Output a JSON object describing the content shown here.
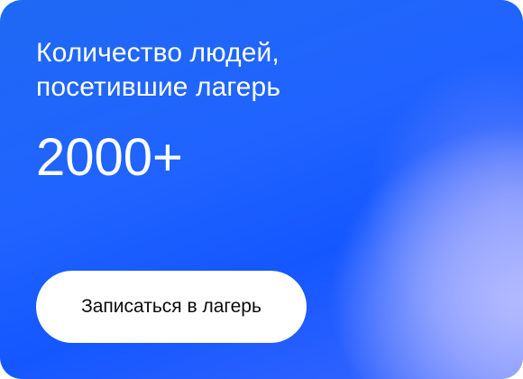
{
  "card": {
    "title_line1": "Количество людей,",
    "title_line2": "посетившие лагерь",
    "count": "2000+",
    "cta_label": "Записаться в лагерь"
  },
  "colors": {
    "accent": "#1f5fff",
    "highlight": "#a9b6ff",
    "text_on_accent": "#ffffff",
    "button_bg": "#ffffff",
    "button_text": "#0a0a0a"
  }
}
